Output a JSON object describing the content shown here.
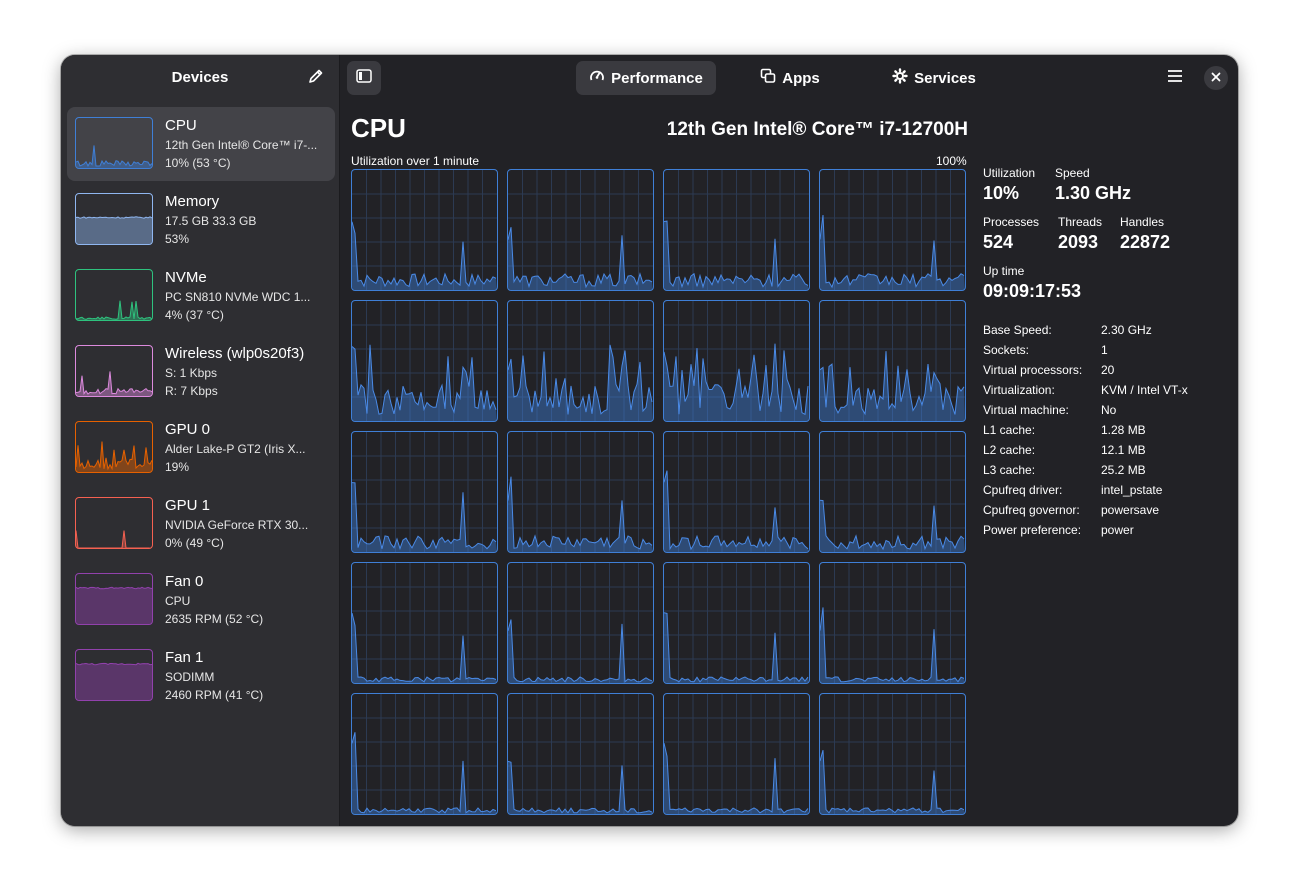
{
  "sidebar": {
    "title": "Devices",
    "items": [
      {
        "name": "CPU",
        "line1": "12th Gen Intel® Core™ i7-...",
        "line2": "10% (53 °C)",
        "color": "#3f7fd6",
        "level": 0.1
      },
      {
        "name": "Memory",
        "line1": "17.5 GB 33.3 GB",
        "line2": "53%",
        "color": "#8fb6f0",
        "level": 0.53
      },
      {
        "name": "NVMe",
        "line1": "PC SN810 NVMe WDC 1...",
        "line2": "4% (37 °C)",
        "color": "#2ec27e",
        "level": 0.04
      },
      {
        "name": "Wireless (wlp0s20f3)",
        "line1": "S: 1 Kbps",
        "line2": "R: 7 Kbps",
        "color": "#dc8add",
        "level": 0.1
      },
      {
        "name": "GPU 0",
        "line1": "Alder Lake-P GT2 (Iris X...",
        "line2": "19%",
        "color": "#e66100",
        "level": 0.19
      },
      {
        "name": "GPU 1",
        "line1": "NVIDIA GeForce RTX 30...",
        "line2": "0% (49 °C)",
        "color": "#f66151",
        "level": 0.0
      },
      {
        "name": "Fan 0",
        "line1": "CPU",
        "line2": "2635 RPM (52 °C)",
        "color": "#9141ac",
        "level": 0.72
      },
      {
        "name": "Fan 1",
        "line1": "SODIMM",
        "line2": "2460 RPM (41 °C)",
        "color": "#9141ac",
        "level": 0.72
      }
    ]
  },
  "tabs": [
    {
      "label": "Performance",
      "icon": "speedometer-icon",
      "active": true
    },
    {
      "label": "Apps",
      "icon": "apps-icon",
      "active": false
    },
    {
      "label": "Services",
      "icon": "gear-icon",
      "active": false
    }
  ],
  "main": {
    "title": "CPU",
    "model": "12th Gen Intel® Core™ i7-12700H",
    "util_label": "Utilization over 1 minute",
    "util_max": "100%"
  },
  "stats": {
    "utilization_label": "Utilization",
    "utilization": "10%",
    "speed_label": "Speed",
    "speed": "1.30 GHz",
    "processes_label": "Processes",
    "processes": "524",
    "threads_label": "Threads",
    "threads": "2093",
    "handles_label": "Handles",
    "handles": "22872",
    "uptime_label": "Up time",
    "uptime": "09:09:17:53"
  },
  "details": [
    {
      "k": "Base Speed:",
      "v": "2.30 GHz"
    },
    {
      "k": "Sockets:",
      "v": "1"
    },
    {
      "k": "Virtual processors:",
      "v": "20"
    },
    {
      "k": "Virtualization:",
      "v": "KVM / Intel VT-x"
    },
    {
      "k": "Virtual machine:",
      "v": "No"
    },
    {
      "k": "L1 cache:",
      "v": "1.28 MB"
    },
    {
      "k": "L2 cache:",
      "v": "12.1 MB"
    },
    {
      "k": "L3 cache:",
      "v": "25.2 MB"
    },
    {
      "k": "Cpufreq driver:",
      "v": "intel_pstate"
    },
    {
      "k": "Cpufreq governor:",
      "v": "powersave"
    },
    {
      "k": "Power preference:",
      "v": "power"
    }
  ],
  "colors": {
    "accent": "#3f7fd6",
    "window_bg": "#222226",
    "sidebar_bg": "#2e2e32"
  }
}
